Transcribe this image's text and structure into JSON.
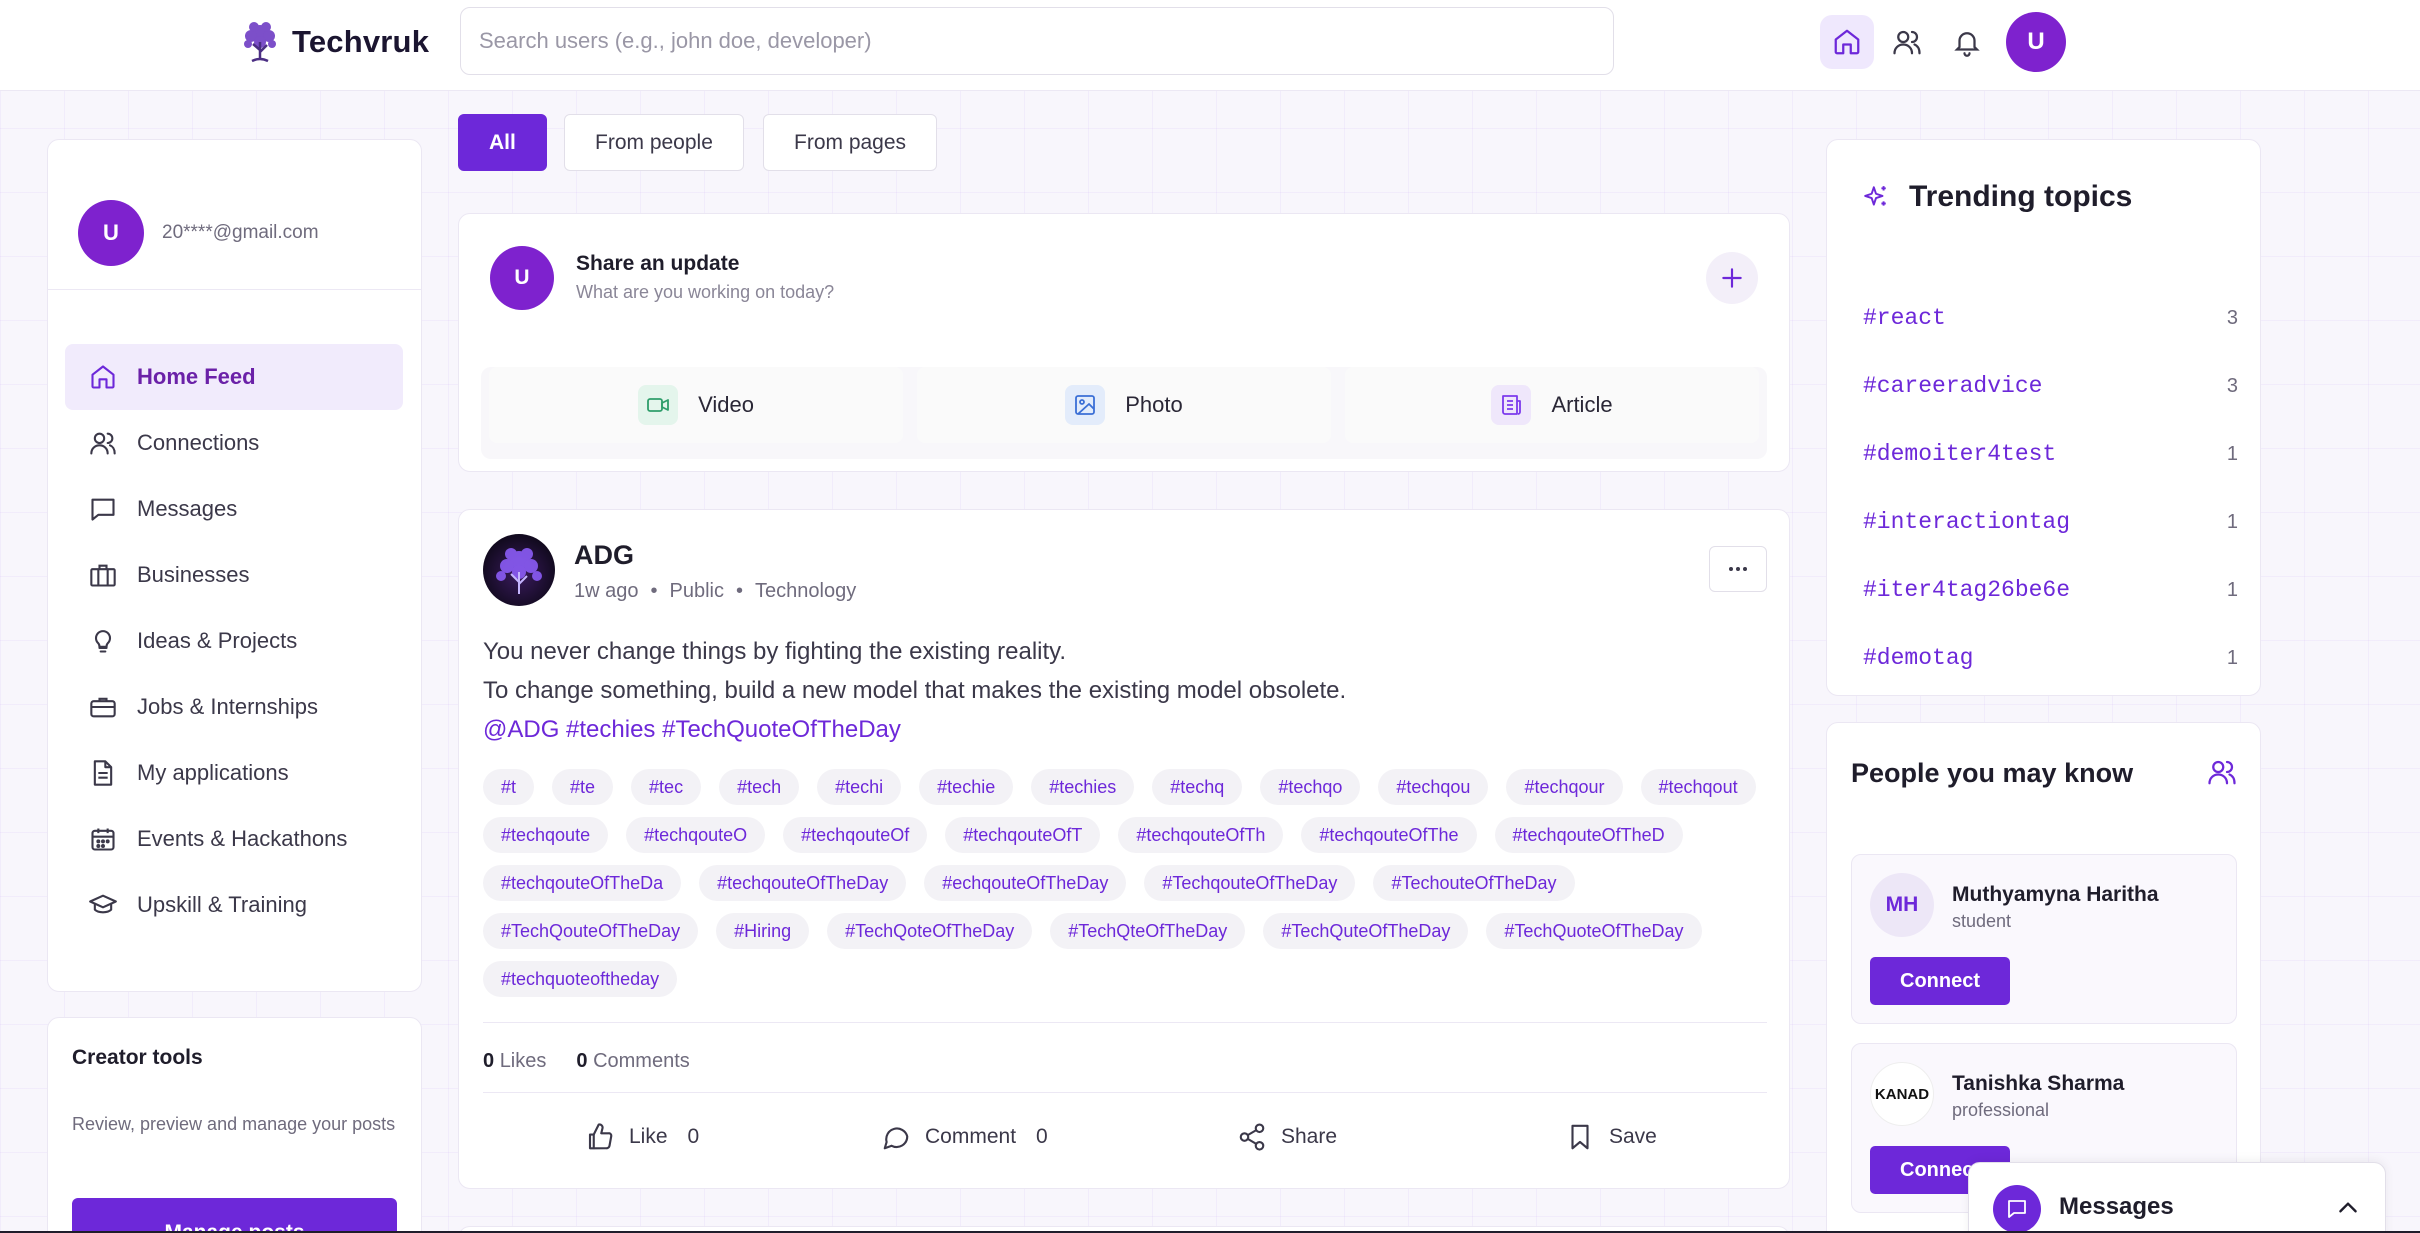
{
  "header": {
    "logo_text": "Techvruk",
    "search_placeholder": "Search users (e.g., john doe, developer)",
    "avatar_initial": "U"
  },
  "sidebar": {
    "avatar_initial": "U",
    "email": "20****@gmail.com",
    "items": [
      {
        "label": "Home Feed",
        "icon": "home-icon"
      },
      {
        "label": "Connections",
        "icon": "users-icon"
      },
      {
        "label": "Messages",
        "icon": "message-icon"
      },
      {
        "label": "Businesses",
        "icon": "building-icon"
      },
      {
        "label": "Ideas & Projects",
        "icon": "lightbulb-icon"
      },
      {
        "label": "Jobs & Internships",
        "icon": "briefcase-icon"
      },
      {
        "label": "My applications",
        "icon": "document-icon"
      },
      {
        "label": "Events & Hackathons",
        "icon": "calendar-icon"
      },
      {
        "label": "Upskill & Training",
        "icon": "graduation-cap-icon"
      }
    ]
  },
  "creator_tools": {
    "title": "Creator tools",
    "description": "Review, preview and manage your posts",
    "button_label": "Manage posts"
  },
  "filters": [
    "All",
    "From people",
    "From pages"
  ],
  "share": {
    "avatar_initial": "U",
    "title": "Share an update",
    "subtitle": "What are you working on today?",
    "actions": [
      "Video",
      "Photo",
      "Article"
    ]
  },
  "post": {
    "author": "ADG",
    "time": "1w ago",
    "visibility": "Public",
    "category": "Technology",
    "line1": "You never change things by fighting the existing reality.",
    "line2": "To change something, build a new model that makes the existing model obsolete.",
    "mentions": "@ADG #techies #TechQuoteOfTheDay",
    "tags": [
      "#t",
      "#te",
      "#tec",
      "#tech",
      "#techi",
      "#techie",
      "#techies",
      "#techq",
      "#techqo",
      "#techqou",
      "#techqour",
      "#techqout",
      "#techqoute",
      "#techqouteO",
      "#techqouteOf",
      "#techqouteOfT",
      "#techqouteOfTh",
      "#techqouteOfThe",
      "#techqouteOfTheD",
      "#techqouteOfTheDa",
      "#techqouteOfTheDay",
      "#echqouteOfTheDay",
      "#TechqouteOfTheDay",
      "#TechouteOfTheDay",
      "#TechQouteOfTheDay",
      "#Hiring",
      "#TechQoteOfTheDay",
      "#TechQteOfTheDay",
      "#TechQuteOfTheDay",
      "#TechQuoteOfTheDay",
      "#techquoteoftheday"
    ],
    "likes_count": "0",
    "likes_label": "Likes",
    "comments_count": "0",
    "comments_label": "Comments",
    "actions": {
      "like": "Like",
      "like_count": "0",
      "comment": "Comment",
      "comment_count": "0",
      "share": "Share",
      "save": "Save"
    }
  },
  "trending": {
    "title": "Trending topics",
    "items": [
      {
        "tag": "#react",
        "count": "3"
      },
      {
        "tag": "#careeradvice",
        "count": "3"
      },
      {
        "tag": "#demoiter4test",
        "count": "1"
      },
      {
        "tag": "#interactiontag",
        "count": "1"
      },
      {
        "tag": "#iter4tag26be6e",
        "count": "1"
      },
      {
        "tag": "#demotag",
        "count": "1"
      }
    ]
  },
  "people": {
    "title": "People you may know",
    "items": [
      {
        "initials": "MH",
        "name": "Muthyamyna Haritha",
        "role": "student",
        "button": "Connect"
      },
      {
        "initials": "KANAD",
        "name": "Tanishka Sharma",
        "role": "professional",
        "button": "Connect"
      }
    ]
  },
  "messages_bar": {
    "label": "Messages"
  },
  "colors": {
    "accent": "#6d28d9",
    "accent_light": "#f1ebfc",
    "avatar": "#7e22ce"
  }
}
